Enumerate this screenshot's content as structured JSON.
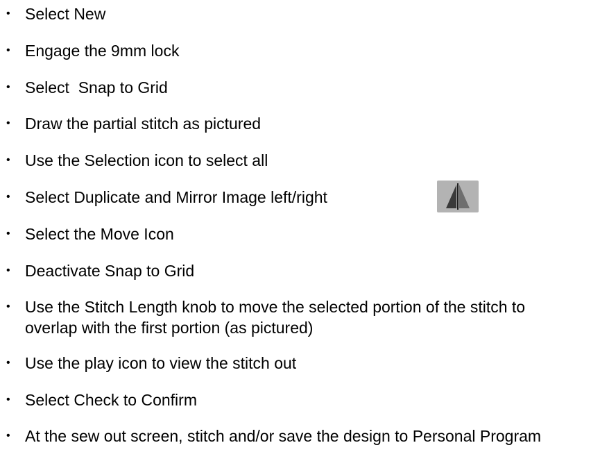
{
  "instructions": {
    "steps": [
      "Select New",
      "Engage the 9mm lock",
      "Select  Snap to Grid",
      "Draw the partial stitch as pictured",
      "Use the Selection icon to select all",
      "Select Duplicate and Mirror Image left/right",
      "Select the Move Icon",
      "Deactivate Snap to Grid",
      "Use the Stitch Length knob to move the selected portion of the stitch to overlap with the first portion (as pictured)",
      "Use the play icon to view the stitch out",
      "Select Check to Confirm",
      "At the sew out screen, stitch and/or save the design to Personal Program"
    ],
    "bullet_glyph": "•",
    "mirror_icon": "mirror-left-right-icon"
  },
  "colors": {
    "text": "#000000",
    "icon_background": "#b3b3b3",
    "icon_triangle_dark": "#3a3a3a",
    "icon_triangle_light": "#6e6e6e"
  }
}
